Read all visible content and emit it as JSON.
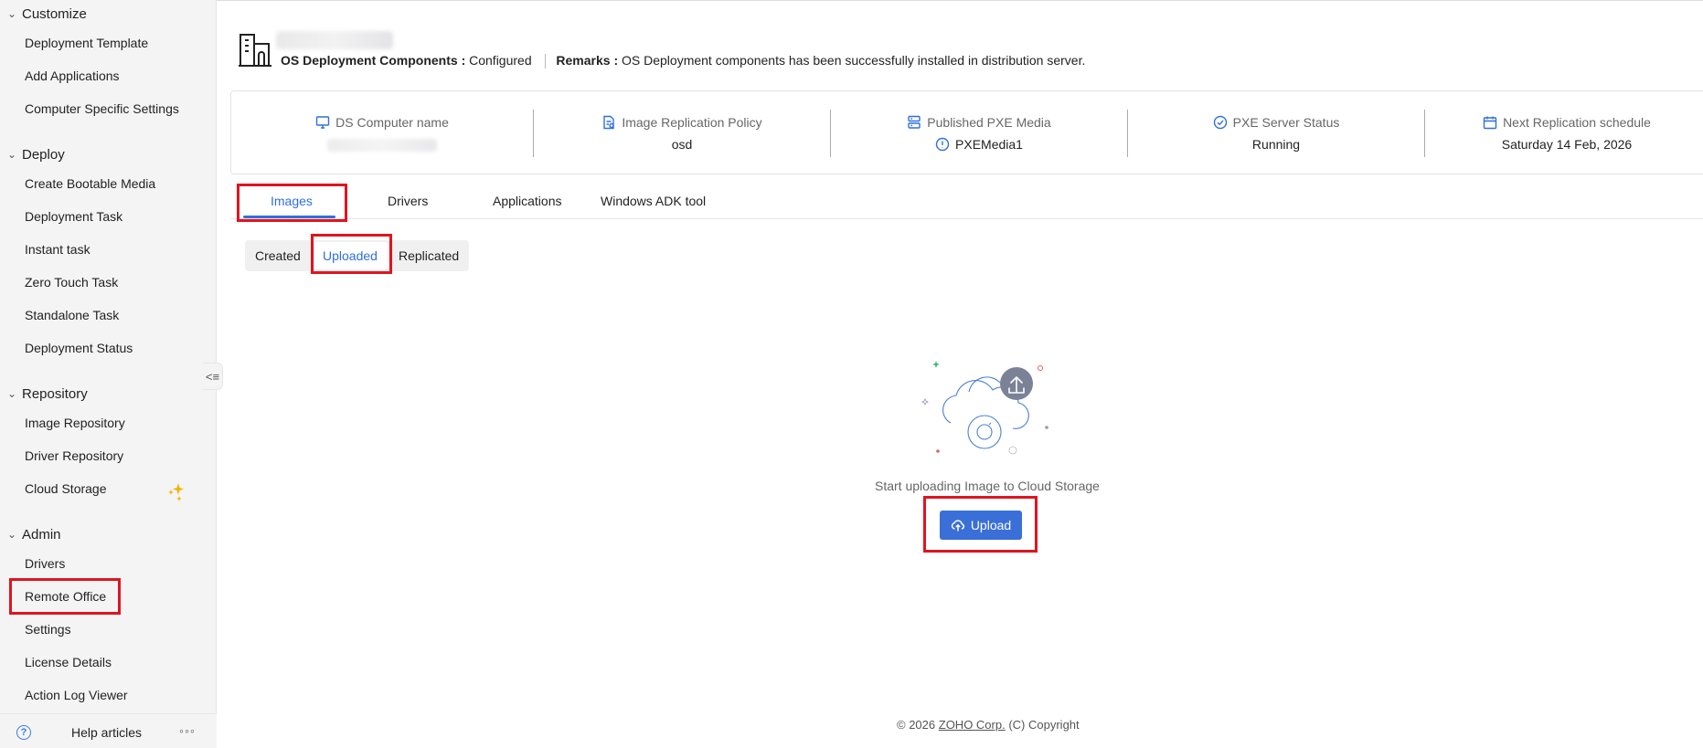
{
  "sidebar": {
    "sections": [
      {
        "label": "Customize",
        "items": [
          "Deployment Template",
          "Add Applications",
          "Computer Specific Settings"
        ]
      },
      {
        "label": "Deploy",
        "items": [
          "Create Bootable Media",
          "Deployment Task",
          "Instant task",
          "Zero Touch Task",
          "Standalone Task",
          "Deployment Status"
        ]
      },
      {
        "label": "Repository",
        "items": [
          "Image Repository",
          "Driver Repository",
          "Cloud Storage"
        ]
      },
      {
        "label": "Admin",
        "items": [
          "Drivers",
          "Remote Office",
          "Settings",
          "License Details",
          "Action Log Viewer"
        ]
      }
    ],
    "footer": {
      "help_label": "Help articles"
    }
  },
  "header": {
    "components_label": "OS Deployment Components :",
    "components_value": "Configured",
    "remarks_label": "Remarks :",
    "remarks_value": "OS Deployment components has been successfully installed in distribution server."
  },
  "info": {
    "ds_computer_name_label": "DS Computer name",
    "image_replication_policy_label": "Image Replication Policy",
    "image_replication_policy_value": "osd",
    "published_pxe_media_label": "Published PXE Media",
    "published_pxe_media_value": "PXEMedia1",
    "pxe_server_status_label": "PXE Server Status",
    "pxe_server_status_value": "Running",
    "next_replication_label": "Next Replication schedule",
    "next_replication_value": "Saturday 14 Feb, 2026"
  },
  "tabs": [
    "Images",
    "Drivers",
    "Applications",
    "Windows ADK tool"
  ],
  "subtabs": [
    "Created",
    "Uploaded",
    "Replicated"
  ],
  "empty_state": {
    "message": "Start uploading Image to Cloud Storage",
    "button": "Upload"
  },
  "footer": {
    "prefix": "© 2026",
    "link": "ZOHO Corp.",
    "suffix": "(C) Copyright"
  },
  "colors": {
    "accent": "#2f6fdf",
    "button": "#3a6fd8",
    "highlight": "#e0141e"
  }
}
